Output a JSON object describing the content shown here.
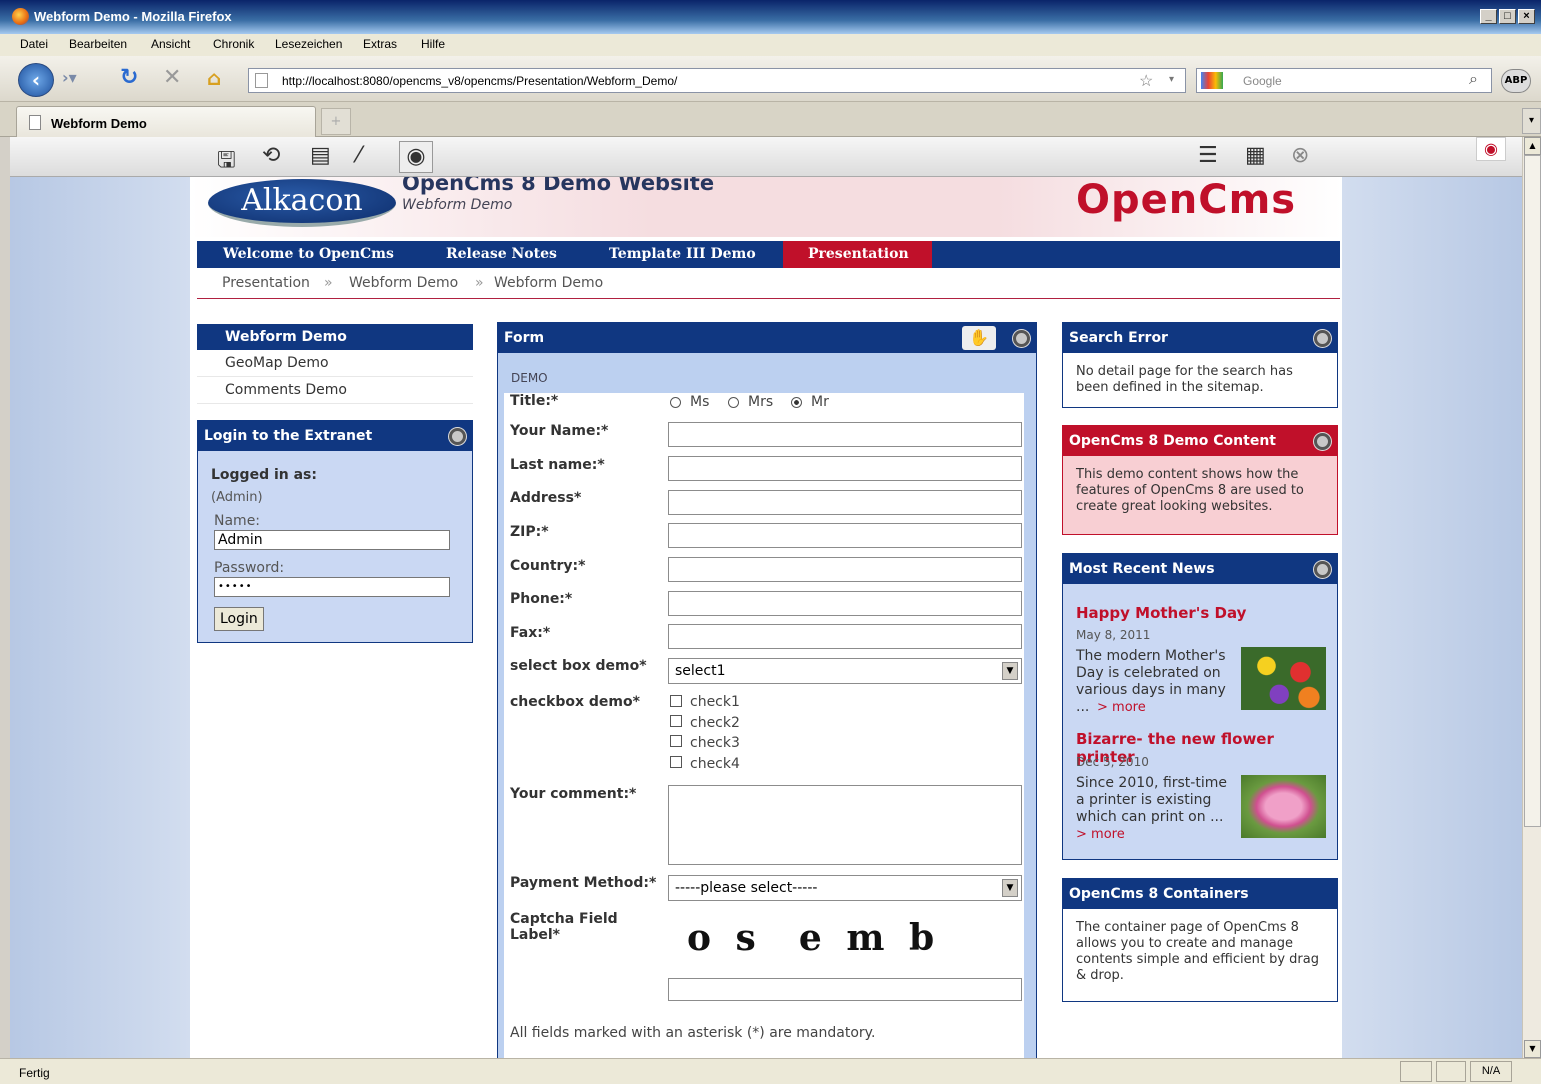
{
  "window": {
    "title": "Webform Demo - Mozilla Firefox",
    "minimize": "_",
    "maximize": "□",
    "close": "×"
  },
  "menu": [
    "Datei",
    "Bearbeiten",
    "Ansicht",
    "Chronik",
    "Lesezeichen",
    "Extras",
    "Hilfe"
  ],
  "nav": {
    "url": "http://localhost:8080/opencms_v8/opencms/Presentation/Webform_Demo/",
    "search_placeholder": "Google",
    "abp": "ABP"
  },
  "tab": {
    "label": "Webform Demo"
  },
  "site": {
    "logo_text": "Alkacon",
    "title": "OpenCms 8 Demo Website",
    "subtitle": "Webform Demo",
    "brand": "OpenCms"
  },
  "main_nav": [
    "Welcome to OpenCms",
    "Release Notes",
    "Template III Demo",
    "Presentation"
  ],
  "breadcrumb": [
    "Presentation",
    "»",
    "Webform Demo",
    "»",
    "Webform Demo"
  ],
  "left_nav": {
    "active": "Webform Demo",
    "items": [
      "GeoMap Demo",
      "Comments Demo"
    ]
  },
  "login": {
    "title": "Login to the Extranet",
    "logged_in_as": "Logged in as:",
    "user": "(Admin)",
    "name_label": "Name:",
    "name_value": "Admin",
    "password_label": "Password:",
    "password_value": "•••••",
    "button": "Login"
  },
  "form": {
    "title": "Form",
    "section": "DEMO",
    "title_label": "Title:*",
    "radio": [
      "Ms",
      "Mrs",
      "Mr"
    ],
    "radio_selected": "Mr",
    "fields": [
      "Your Name:*",
      "Last name:*",
      "Address*",
      "ZIP:*",
      "Country:*",
      "Phone:*",
      "Fax:*"
    ],
    "select_label": "select box demo*",
    "select_value": "select1",
    "checkbox_label": "checkbox demo*",
    "checkboxes": [
      "check1",
      "check2",
      "check3",
      "check4"
    ],
    "comment_label": "Your comment:*",
    "payment_label": "Payment Method:*",
    "payment_value": "-----please select-----",
    "captcha_label": "Captcha Field Label*",
    "captcha_text": "o s  e m b",
    "mandatory_note": "All fields marked with an asterisk (*) are mandatory."
  },
  "right": {
    "search_error": {
      "title": "Search Error",
      "text": "No detail page for the search has been defined in the sitemap."
    },
    "demo_content": {
      "title": "OpenCms 8 Demo Content",
      "text": "This demo content shows how the features of OpenCms 8 are used to create great looking websites."
    },
    "news": {
      "title": "Most Recent News",
      "items": [
        {
          "headline": "Happy Mother's Day",
          "date": "May 8, 2011",
          "text": "The modern Mother's Day is celebrated on various days in many ...",
          "more": "> more"
        },
        {
          "headline": "Bizarre- the new flower printer",
          "date": "Dec 5, 2010",
          "text": "Since 2010, first-time a printer is existing which can print on ...",
          "more": "> more"
        }
      ]
    },
    "containers": {
      "title": "OpenCms 8 Containers",
      "text": "The container page of OpenCms 8 allows you to create and manage contents simple and efficient by drag & drop."
    }
  },
  "status": {
    "text": "Fertig",
    "na": "N/A"
  }
}
